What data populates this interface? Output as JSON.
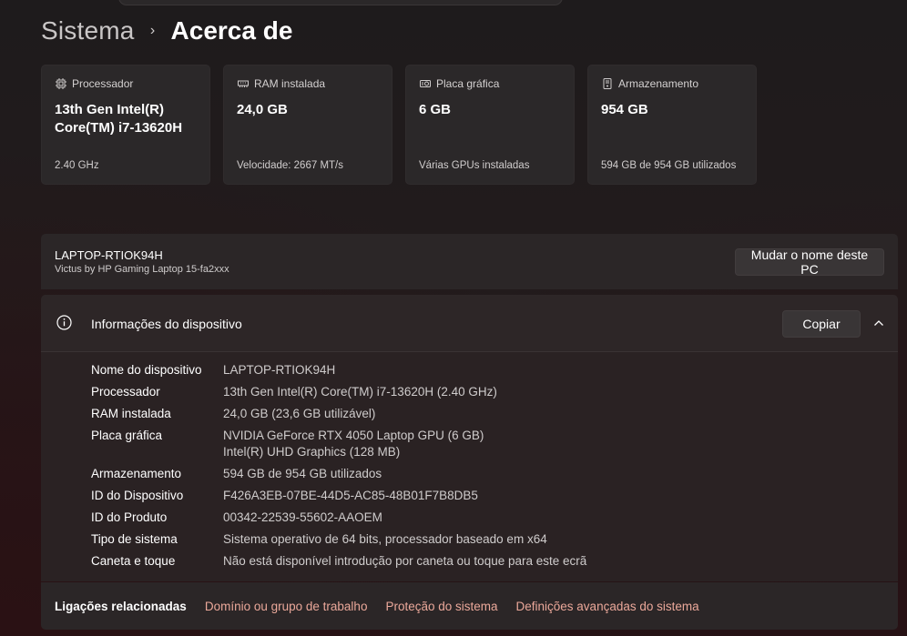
{
  "breadcrumb": {
    "parent": "Sistema",
    "separator": "›",
    "current": "Acerca de"
  },
  "cards": [
    {
      "label": "Processador",
      "value": "13th Gen Intel(R) Core(TM) i7-13620H",
      "sub": "2.40 GHz",
      "icon": "cpu-icon"
    },
    {
      "label": "RAM instalada",
      "value": "24,0 GB",
      "sub": "Velocidade: 2667 MT/s",
      "icon": "ram-icon"
    },
    {
      "label": "Placa gráfica",
      "value": "6 GB",
      "sub": "Várias GPUs instaladas",
      "icon": "gpu-icon"
    },
    {
      "label": "Armazenamento",
      "value": "954 GB",
      "sub": "594 GB de 954 GB utilizados",
      "icon": "storage-icon"
    }
  ],
  "pc": {
    "name": "LAPTOP-RTIOK94H",
    "model": "Victus by HP Gaming Laptop 15-fa2xxx",
    "rename_button": "Mudar o nome deste PC"
  },
  "device_info": {
    "title": "Informações do dispositivo",
    "copy_button": "Copiar",
    "rows": [
      {
        "label": "Nome do dispositivo",
        "value": "LAPTOP-RTIOK94H"
      },
      {
        "label": "Processador",
        "value": "13th Gen Intel(R) Core(TM) i7-13620H (2.40 GHz)"
      },
      {
        "label": "RAM instalada",
        "value": "24,0 GB (23,6 GB utilizável)"
      },
      {
        "label": "Placa gráfica",
        "value": "NVIDIA GeForce RTX 4050 Laptop GPU (6 GB)",
        "value2": "Intel(R) UHD Graphics (128 MB)"
      },
      {
        "label": "Armazenamento",
        "value": "594 GB de 954 GB utilizados"
      },
      {
        "label": "ID do Dispositivo",
        "value": "F426A3EB-07BE-44D5-AC85-48B01F7B8DB5"
      },
      {
        "label": "ID do Produto",
        "value": "00342-22539-55602-AAOEM"
      },
      {
        "label": "Tipo de sistema",
        "value": "Sistema operativo de 64 bits, processador baseado em x64"
      },
      {
        "label": "Caneta e toque",
        "value": "Não está disponível introdução por caneta ou toque para este ecrã"
      }
    ]
  },
  "related": {
    "label": "Ligações relacionadas",
    "links": [
      "Domínio ou grupo de trabalho",
      "Proteção do sistema",
      "Definições avançadas do sistema"
    ]
  },
  "colors": {
    "link": "#eba89a",
    "card_bg": "#2b2829"
  }
}
